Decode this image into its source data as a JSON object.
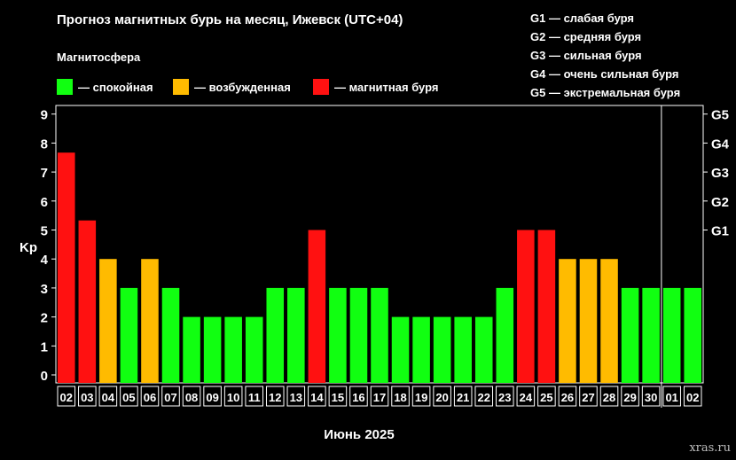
{
  "header": {
    "title": "Прогноз магнитных бурь на месяц, Ижевск (UTC+04)"
  },
  "legend": {
    "heading": "Магнитосфера",
    "items": [
      {
        "label": "— спокойная",
        "color": "#11ff11"
      },
      {
        "label": "— возбужденная",
        "color": "#ffbb00"
      },
      {
        "label": "— магнитная буря",
        "color": "#ff1111"
      }
    ]
  },
  "storm_scale": [
    "G1 — слабая буря",
    "G2 — средняя буря",
    "G3 — сильная буря",
    "G4 — очень сильная буря",
    "G5 — экстремальная буря"
  ],
  "watermark": "xras.ru",
  "chart_data": {
    "type": "bar",
    "xlabel": "Июнь 2025",
    "ylabel": "Kp",
    "ylim": [
      0,
      9
    ],
    "yticks": [
      0,
      1,
      2,
      3,
      4,
      5,
      6,
      7,
      8,
      9
    ],
    "right_axis": [
      {
        "label": "G1",
        "kp": 5
      },
      {
        "label": "G2",
        "kp": 6
      },
      {
        "label": "G3",
        "kp": 7
      },
      {
        "label": "G4",
        "kp": 8
      },
      {
        "label": "G5",
        "kp": 9
      }
    ],
    "categories": [
      "02",
      "03",
      "04",
      "05",
      "06",
      "07",
      "08",
      "09",
      "10",
      "11",
      "12",
      "13",
      "14",
      "15",
      "16",
      "17",
      "18",
      "19",
      "20",
      "21",
      "22",
      "23",
      "24",
      "25",
      "26",
      "27",
      "28",
      "29",
      "30",
      "01",
      "02"
    ],
    "values": [
      7.67,
      5.33,
      4,
      3,
      4,
      3,
      2,
      2,
      2,
      2,
      3,
      3,
      5,
      3,
      3,
      3,
      2,
      2,
      2,
      2,
      2,
      3,
      5,
      5,
      4,
      4,
      4,
      3,
      3,
      3,
      3
    ],
    "levels": [
      "storm",
      "storm",
      "active",
      "quiet",
      "active",
      "quiet",
      "quiet",
      "quiet",
      "quiet",
      "quiet",
      "quiet",
      "quiet",
      "storm",
      "quiet",
      "quiet",
      "quiet",
      "quiet",
      "quiet",
      "quiet",
      "quiet",
      "quiet",
      "quiet",
      "storm",
      "storm",
      "active",
      "active",
      "active",
      "quiet",
      "quiet",
      "quiet",
      "quiet"
    ],
    "level_colors": {
      "quiet": "#11ff11",
      "active": "#ffbb00",
      "storm": "#ff1111"
    },
    "month_separator_before": "01",
    "grid": true
  }
}
